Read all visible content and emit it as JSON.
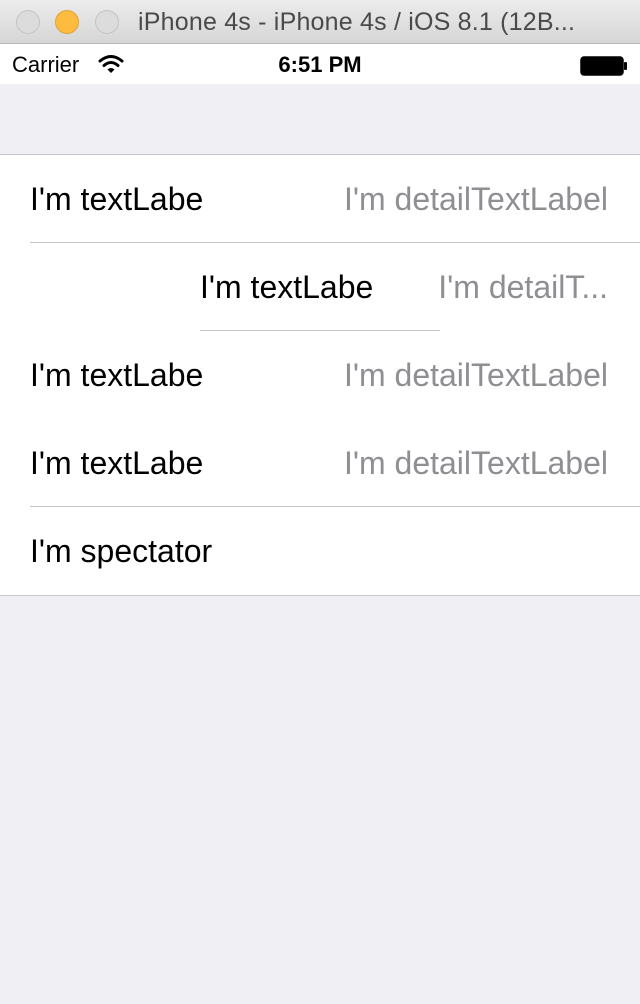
{
  "window": {
    "title": "iPhone 4s - iPhone 4s / iOS 8.1 (12B..."
  },
  "statusbar": {
    "carrier": "Carrier",
    "time": "6:51 PM"
  },
  "icons": {
    "wifi": "wifi-icon",
    "battery": "battery-icon"
  },
  "table": {
    "rows": [
      {
        "text": "I'm textLabe",
        "detail": "I'm detailTextLabel"
      },
      {
        "text": "I'm textLabe",
        "detail": "I'm detailT..."
      },
      {
        "text": "I'm textLabe",
        "detail": "I'm detailTextLabel"
      },
      {
        "text": "I'm textLabe",
        "detail": "I'm detailTextLabel"
      },
      {
        "text": "I'm spectator",
        "detail": ""
      }
    ]
  },
  "colors": {
    "background": "#efeff4",
    "detail_text": "#8e8e93",
    "separator": "#c8c7cc",
    "minimize_button": "#fdbc40"
  }
}
